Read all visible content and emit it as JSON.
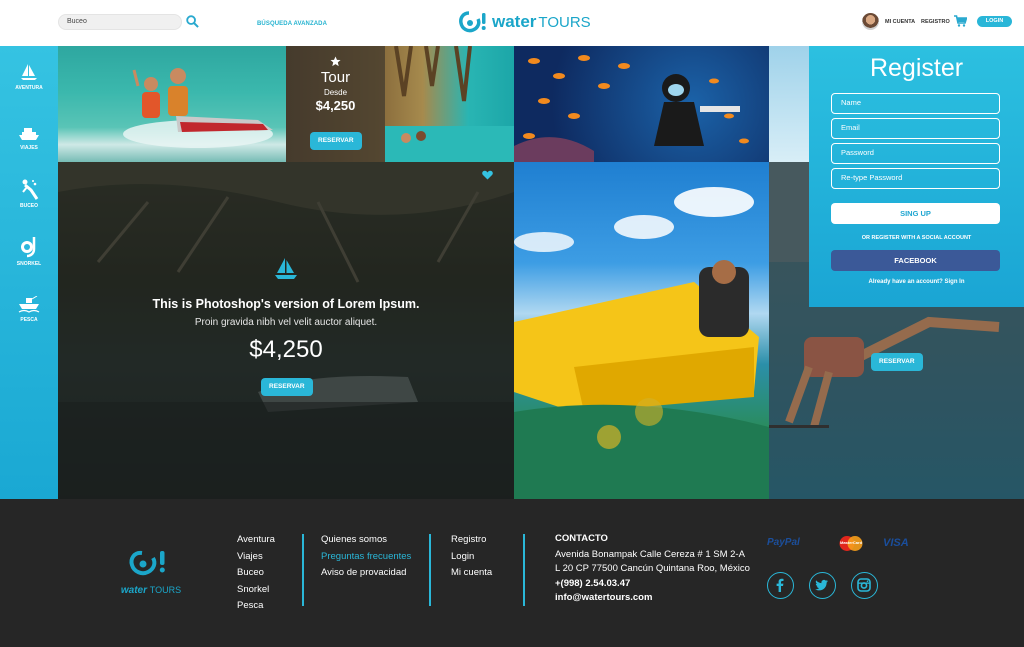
{
  "header": {
    "search_value": "Buceo",
    "advanced_search": "BÚSQUEDA AVANZADA",
    "logo_water": "water",
    "logo_tours": "TOURS",
    "my_account": "MI CUENTA",
    "register": "REGISTRO",
    "login": "LOGIN"
  },
  "sidebar": {
    "items": [
      {
        "label": "AVENTURA",
        "icon": "sail-icon"
      },
      {
        "label": "VIAJES",
        "icon": "ship-icon"
      },
      {
        "label": "BUCEO",
        "icon": "diver-icon"
      },
      {
        "label": "SNORKEL",
        "icon": "snorkel-icon"
      },
      {
        "label": "PESCA",
        "icon": "fishing-boat-icon"
      }
    ]
  },
  "tiles": {
    "tour_card": {
      "title": "Tour",
      "from": "Desde",
      "price": "$4,250",
      "button": "RESERVAR"
    },
    "hero": {
      "title": "This is Photoshop's version  of Lorem Ipsum.",
      "subtitle": "Proin gravida nibh vel velit auctor aliquet.",
      "price": "$4,250",
      "button": "RESERVAR"
    },
    "right_card": {
      "button": "RESERVAR"
    }
  },
  "register": {
    "title": "Register",
    "name_placeholder": "Name",
    "email_placeholder": "Email",
    "password_placeholder": "Password",
    "retype_placeholder": "Re-type Password",
    "signup": "SING UP",
    "or_social": "OR REGISTER WITH A SOCIAL ACCOUNT",
    "facebook": "FACEBOOK",
    "already": "Already have an account? Sign In"
  },
  "footer": {
    "logo_water": "water",
    "logo_tours": "TOURS",
    "col1": [
      "Aventura",
      "Viajes",
      "Buceo",
      "Snorkel",
      "Pesca"
    ],
    "col2": [
      "Quienes somos",
      "Preguntas frecuentes",
      "Aviso de provacidad"
    ],
    "col3": [
      "Registro",
      "Login",
      "Mi cuenta"
    ],
    "contact": {
      "title": "CONTACTO",
      "line1": "Avenida Bonampak Calle Cereza # 1 SM 2-A",
      "line2": "L 20 CP 77500 Cancún Quintana Roo, México",
      "phone": "+(998) 2.54.03.47",
      "email": "info@watertours.com"
    },
    "payments": {
      "paypal": "PayPal",
      "mastercard": "MasterCard",
      "visa": "VISA"
    }
  },
  "colors": {
    "accent": "#2ab7d8",
    "facebook": "#3b5998",
    "footer_bg": "#262626"
  }
}
